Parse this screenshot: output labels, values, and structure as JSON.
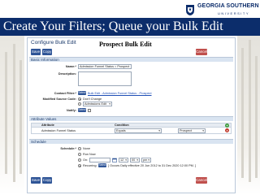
{
  "header": {
    "title": "Create Your Filters; Queue your Bulk Edit",
    "logo_name": "GEORGIA SOUTHERN",
    "logo_sub": "UNIVERSITY"
  },
  "panel": {
    "title": "Configure Bulk Edit",
    "prospect_label": "Prospect Bulk Edit",
    "save_label": "Save",
    "copy_label": "Copy",
    "cancel_label": "Cancel"
  },
  "basic_info": {
    "section_label": "Basic Information",
    "name_label": "Name:*",
    "name_value": "Admission Funnel Status = Prospect",
    "description_label": "Description:",
    "contact_filter_label": "Contact Filter:*",
    "contact_filter_button": "Select",
    "contact_filter_value": "Bulk Edit - Admission Funnel Status - Prospect",
    "modified_source_label": "Modified Source Code:",
    "modified_source_option": "Don't Change",
    "modified_source_select": "Admissions Edit",
    "notify_label": "Notify:",
    "notify_button": "Select"
  },
  "attribute_values": {
    "section_label": "Attribute Values",
    "col_attribute": "Attribute",
    "col_condition": "Condition",
    "row_attribute": "Admission Funnel Status",
    "row_condition": "Equals",
    "row_value": "Prospect"
  },
  "schedule": {
    "section_label": "Schedule",
    "schedule_label": "Schedule:*",
    "option_none": "None",
    "option_run_now": "Run Now",
    "option_on": "On:",
    "on_hour": "12",
    "on_minute": "00",
    "on_ampm": "pm",
    "option_recurring": "Recurring:",
    "recurring_button": "Select",
    "recurring_value": "[ Occurs Daily effective 20 Jun 2012 to 31 Dec 2020 12:00 PM. ]"
  },
  "footer": {
    "save_label": "Save",
    "copy_label": "Copy",
    "cancel_label": "Cancel"
  }
}
